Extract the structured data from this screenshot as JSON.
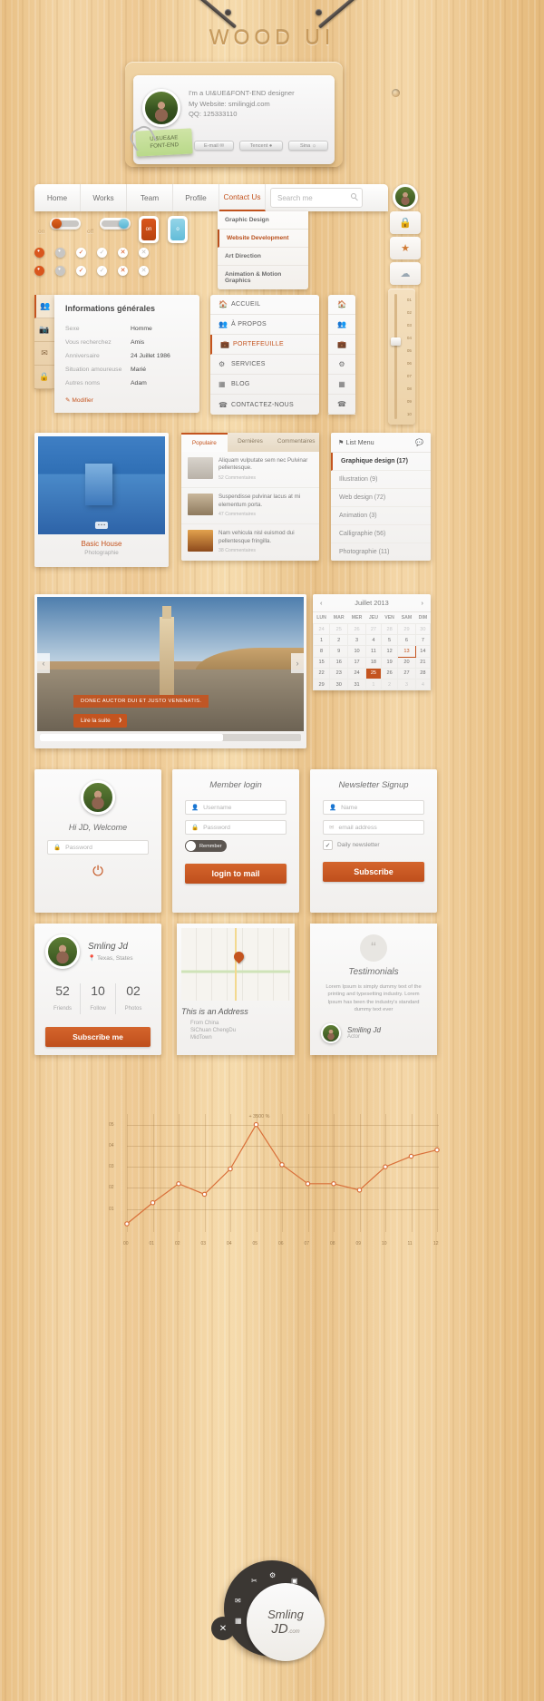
{
  "header": {
    "title": "WOOD UI",
    "card": {
      "line1": "I'm a UI&UE&FONT-END designer",
      "line2": "My Website: smilingjd.com",
      "line3": "QQ: 125333110",
      "note_line1": "UI&UE&AE",
      "note_line2": "FONT-END",
      "buttons": [
        {
          "label": "E-mail",
          "icon": "envelope-icon"
        },
        {
          "label": "Tencent",
          "icon": "penguin-icon"
        },
        {
          "label": "Sina",
          "icon": "weibo-icon"
        }
      ]
    }
  },
  "nav": {
    "items": [
      {
        "label": "Home",
        "active": false
      },
      {
        "label": "Works",
        "active": false
      },
      {
        "label": "Team",
        "active": false
      },
      {
        "label": "Profile",
        "active": false
      },
      {
        "label": "Contact Us",
        "active": true
      }
    ],
    "search_placeholder": "Search me",
    "search_value": "",
    "dropdown": [
      {
        "label": "Graphic Design",
        "active": false
      },
      {
        "label": "Website Development",
        "active": true
      },
      {
        "label": "Art Direction",
        "active": false
      },
      {
        "label": "Animation & Motion Graphics",
        "active": false
      }
    ]
  },
  "toggles": {
    "label_on": "on",
    "label_off": "off",
    "switch_on_state": "on",
    "switch_off_state": "off",
    "square_on": "on",
    "square_off": "o",
    "colors": {
      "orange": "#c4541f",
      "blue": "#6fc2dd",
      "grey": "#c9c7c4"
    },
    "dot_row1": [
      "dot-filled-orange",
      "dot-filled-grey",
      "check-orange",
      "check-grey",
      "cross-orange",
      "cross-grey"
    ],
    "dot_row2": [
      "dot-filled-orange",
      "dot-filled-grey",
      "check-orange",
      "check-grey",
      "cross-orange",
      "cross-grey"
    ]
  },
  "info_panel": {
    "title": "Informations générales",
    "side_tabs": [
      "users-icon",
      "image-icon",
      "mail-icon",
      "lock-icon"
    ],
    "rows": [
      {
        "key": "Sexe",
        "value": "Homme"
      },
      {
        "key": "Vous recherchez",
        "value": "Amis"
      },
      {
        "key": "Anniversaire",
        "value": "24 Juillet 1986"
      },
      {
        "key": "Situation amoureuse",
        "value": "Marié"
      },
      {
        "key": "Autres noms",
        "value": "Adam"
      }
    ],
    "edit_label": "Modifier"
  },
  "vmenu": {
    "items": [
      {
        "label": "ACCUEIL",
        "icon": "home-icon",
        "active": false
      },
      {
        "label": "À PROPOS",
        "icon": "users-icon",
        "active": false
      },
      {
        "label": "PORTEFEUILLE",
        "icon": "briefcase-icon",
        "active": true
      },
      {
        "label": "SERVICES",
        "icon": "gear-icon",
        "active": false
      },
      {
        "label": "BLOG",
        "icon": "grid-icon",
        "active": false
      },
      {
        "label": "CONTACTEZ-NOUS",
        "icon": "phone-icon",
        "active": false
      }
    ],
    "icon_only": [
      "home-icon",
      "users-icon",
      "briefcase-icon",
      "gear-icon",
      "grid-icon",
      "phone-icon"
    ]
  },
  "right_buttons": [
    {
      "icon": "lock-icon"
    },
    {
      "icon": "star-icon"
    },
    {
      "icon": "cloud-icon"
    }
  ],
  "slider": {
    "ticks": [
      "01",
      "02",
      "03",
      "04",
      "05",
      "06",
      "07",
      "08",
      "09",
      "10"
    ],
    "value": "04"
  },
  "gallery": {
    "title": "Basic House",
    "subtitle": "Photographie",
    "dots": "▪ ▪ ▪"
  },
  "tabbox": {
    "tabs": [
      {
        "label": "Populaire",
        "active": true
      },
      {
        "label": "Dernières",
        "active": false
      },
      {
        "label": "Commentaires",
        "active": false
      }
    ],
    "rows": [
      {
        "text": "Aliquam vulputate sem nec Pulvinar pellentesque.",
        "comments": "52 Commentaires"
      },
      {
        "text": "Suspendisse pulvinar lacus at mi elementum porta.",
        "comments": "47 Commentaires"
      },
      {
        "text": "Nam vehicula nisl euismod dui pellentesque fringilla.",
        "comments": "38 Commentaires"
      }
    ]
  },
  "listmenu": {
    "title": "List Menu",
    "head_icons": [
      "tag-icon",
      "comment-icon"
    ],
    "items": [
      {
        "label": "Graphique design (17)",
        "active": true
      },
      {
        "label": "Illustration (9)",
        "active": false
      },
      {
        "label": "Web design (72)",
        "active": false
      },
      {
        "label": "Animation (3)",
        "active": false
      },
      {
        "label": "Calligraphie (56)",
        "active": false
      },
      {
        "label": "Photographie (11)",
        "active": false
      }
    ]
  },
  "hero": {
    "caption": "DONEC AUCTOR DUI ET JUSTO VENENATIS.",
    "button": "Lire la suite",
    "prev_icon": "chevron-left-icon",
    "next_icon": "chevron-right-icon"
  },
  "calendar": {
    "title": "Juillet 2013",
    "prev": "‹",
    "next": "›",
    "weekdays": [
      "LUN",
      "MAR",
      "MER",
      "JEU",
      "VEN",
      "SAM",
      "DIM"
    ],
    "weeks": [
      [
        {
          "d": "24",
          "m": true
        },
        {
          "d": "25",
          "m": true
        },
        {
          "d": "26",
          "m": true
        },
        {
          "d": "27",
          "m": true
        },
        {
          "d": "28",
          "m": true
        },
        {
          "d": "29",
          "m": true
        },
        {
          "d": "30",
          "m": true
        }
      ],
      [
        {
          "d": "1"
        },
        {
          "d": "2"
        },
        {
          "d": "3"
        },
        {
          "d": "4"
        },
        {
          "d": "5"
        },
        {
          "d": "6"
        },
        {
          "d": "7"
        }
      ],
      [
        {
          "d": "8"
        },
        {
          "d": "9"
        },
        {
          "d": "10"
        },
        {
          "d": "11"
        },
        {
          "d": "12"
        },
        {
          "d": "13",
          "sel": true
        },
        {
          "d": "14"
        }
      ],
      [
        {
          "d": "15"
        },
        {
          "d": "16"
        },
        {
          "d": "17"
        },
        {
          "d": "18"
        },
        {
          "d": "19"
        },
        {
          "d": "20"
        },
        {
          "d": "21"
        }
      ],
      [
        {
          "d": "22"
        },
        {
          "d": "23"
        },
        {
          "d": "24"
        },
        {
          "d": "25",
          "act": true
        },
        {
          "d": "26"
        },
        {
          "d": "27"
        },
        {
          "d": "28"
        }
      ],
      [
        {
          "d": "29"
        },
        {
          "d": "30"
        },
        {
          "d": "31"
        },
        {
          "d": "1",
          "m": true
        },
        {
          "d": "2",
          "m": true
        },
        {
          "d": "3",
          "m": true
        },
        {
          "d": "4",
          "m": true
        }
      ]
    ]
  },
  "welcome_card": {
    "greeting": "Hi JD, Welcome",
    "password_placeholder": "Password",
    "power_icon": "power-icon"
  },
  "login_card": {
    "title": "Member login",
    "username_placeholder": "Username",
    "password_placeholder": "Password",
    "remember_label": "Remmber",
    "button": "login to mail"
  },
  "newsletter_card": {
    "title": "Newsletter Signup",
    "name_placeholder": "Name",
    "email_placeholder": "email address",
    "checkbox_label": "Daily newsletter",
    "button": "Subscribe"
  },
  "profile_card": {
    "name": "Smling Jd",
    "location": "Texas, States",
    "stats": [
      {
        "value": "52",
        "label": "Friends"
      },
      {
        "value": "10",
        "label": "Follow"
      },
      {
        "value": "02",
        "label": "Photos"
      }
    ],
    "button": "Subscribe me"
  },
  "address_card": {
    "title": "This is an Address",
    "lines": [
      "From China",
      "SiChuan ChengDu",
      "MidTown"
    ]
  },
  "testimonial_card": {
    "title": "Testimonials",
    "text": "Lorem Ipsum is simply dummy text of the printing and typesetting industry. Lorem Ipsum has been the industry's standard dummy text ever",
    "author": "Smiling Jd",
    "role": "Actor"
  },
  "footer": {
    "name_line1": "Smling",
    "name_line2": "JD",
    "name_suffix": ".com",
    "close_icon": "close-icon",
    "ring_icons": [
      "scissors-icon",
      "gear-icon",
      "image-icon",
      "mail-icon",
      "grid-icon",
      "bars-icon"
    ]
  },
  "chart_data": {
    "type": "line",
    "title": "",
    "annotation": "+ 3500 %",
    "x": [
      "00",
      "01",
      "02",
      "03",
      "04",
      "05",
      "06",
      "07",
      "08",
      "09",
      "10",
      "11",
      "12"
    ],
    "values": [
      0.03,
      0.13,
      0.22,
      0.17,
      0.29,
      0.5,
      0.31,
      0.22,
      0.22,
      0.19,
      0.3,
      0.35,
      0.38
    ],
    "ylabels": [
      "01",
      "02",
      "03",
      "04",
      "05"
    ],
    "ylim": [
      0,
      0.55
    ],
    "xlabel": "",
    "ylabel": "",
    "grid": true,
    "line_color": "#d9703a",
    "point_color": "#d9703a"
  }
}
